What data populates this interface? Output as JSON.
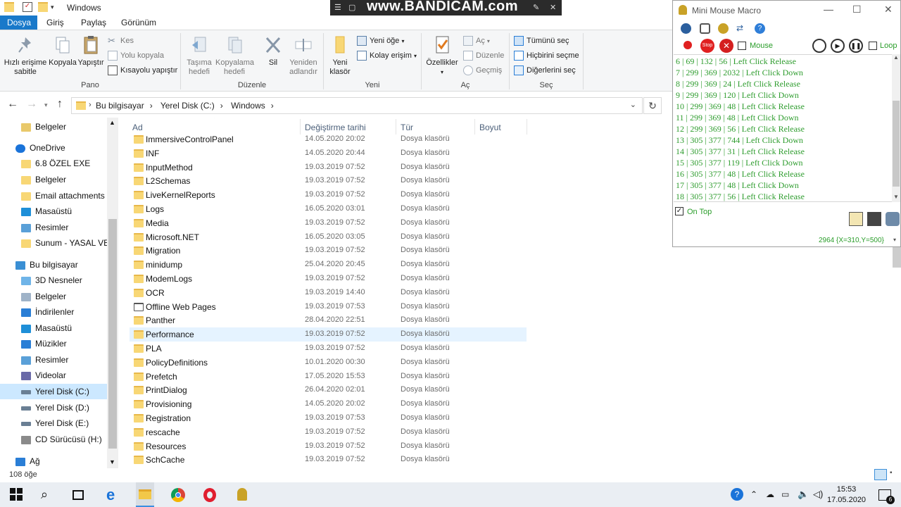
{
  "window": {
    "title": "Windows"
  },
  "tabs": {
    "file": "Dosya",
    "home": "Giriş",
    "share": "Paylaş",
    "view": "Görünüm"
  },
  "ribbon": {
    "pin": "Hızlı erişime sabitle",
    "copy": "Kopyala",
    "paste": "Yapıştır",
    "cut": "Kes",
    "copy_path": "Yolu kopyala",
    "paste_shortcut": "Kısayolu yapıştır",
    "group_clipboard": "Pano",
    "move_to": "Taşıma hedefi",
    "copy_to": "Kopyalama hedefi",
    "delete": "Sil",
    "rename": "Yeniden adlandır",
    "group_organize": "Düzenle",
    "new_folder": "Yeni klasör",
    "new_item": "Yeni öğe",
    "easy_access": "Kolay erişim",
    "group_new": "Yeni",
    "properties": "Özellikler",
    "open": "Aç",
    "edit": "Düzenle",
    "history": "Geçmiş",
    "group_open": "Aç",
    "select_all": "Tümünü seç",
    "select_none": "Hiçbirini seçme",
    "invert_selection": "Diğerlerini seç",
    "group_select": "Seç"
  },
  "address": {
    "crumbs": [
      "Bu bilgisayar",
      "Yerel Disk (C:)",
      "Windows"
    ]
  },
  "nav": {
    "items": [
      {
        "label": "Belgeler",
        "color": "#e9c96b"
      },
      {
        "label": "OneDrive",
        "color": "#1a73d9"
      },
      {
        "label": "6.8 ÖZEL EXE",
        "color": "#f8d775"
      },
      {
        "label": "Belgeler",
        "color": "#f8d775"
      },
      {
        "label": "Email attachments",
        "color": "#f8d775"
      },
      {
        "label": "Masaüstü",
        "color": "#1e8fd8"
      },
      {
        "label": "Resimler",
        "color": "#5aa0d8"
      },
      {
        "label": "Sunum - YASAL VE Y",
        "color": "#f8d775"
      },
      {
        "label": "Bu bilgisayar",
        "color": "#3a8fd4"
      },
      {
        "label": "3D Nesneler",
        "color": "#6fb4e8"
      },
      {
        "label": "Belgeler",
        "color": "#9fb3c8"
      },
      {
        "label": "İndirilenler",
        "color": "#2a7ed6"
      },
      {
        "label": "Masaüstü",
        "color": "#1e8fd8"
      },
      {
        "label": "Müzikler",
        "color": "#2a7ed6"
      },
      {
        "label": "Resimler",
        "color": "#5aa0d8"
      },
      {
        "label": "Videolar",
        "color": "#6a6aa8"
      },
      {
        "label": "Yerel Disk (C:)",
        "color": "#6a7f94"
      },
      {
        "label": "Yerel Disk (D:)",
        "color": "#6a7f94"
      },
      {
        "label": "Yerel Disk (E:)",
        "color": "#6a7f94"
      },
      {
        "label": "CD Sürücüsü (H:)",
        "color": "#8a8a8a"
      },
      {
        "label": "Ağ",
        "color": "#2a7ed6"
      }
    ]
  },
  "columns": {
    "name": "Ad",
    "date": "Değiştirme tarihi",
    "type": "Tür",
    "size": "Boyut"
  },
  "files": [
    {
      "name": "ImmersiveControlPanel",
      "date": "14.05.2020 20:02",
      "type": "Dosya klasörü"
    },
    {
      "name": "INF",
      "date": "14.05.2020 20:44",
      "type": "Dosya klasörü"
    },
    {
      "name": "InputMethod",
      "date": "19.03.2019 07:52",
      "type": "Dosya klasörü"
    },
    {
      "name": "L2Schemas",
      "date": "19.03.2019 07:52",
      "type": "Dosya klasörü"
    },
    {
      "name": "LiveKernelReports",
      "date": "19.03.2019 07:52",
      "type": "Dosya klasörü"
    },
    {
      "name": "Logs",
      "date": "16.05.2020 03:01",
      "type": "Dosya klasörü"
    },
    {
      "name": "Media",
      "date": "19.03.2019 07:52",
      "type": "Dosya klasörü"
    },
    {
      "name": "Microsoft.NET",
      "date": "16.05.2020 03:05",
      "type": "Dosya klasörü"
    },
    {
      "name": "Migration",
      "date": "19.03.2019 07:52",
      "type": "Dosya klasörü"
    },
    {
      "name": "minidump",
      "date": "25.04.2020 20:45",
      "type": "Dosya klasörü"
    },
    {
      "name": "ModemLogs",
      "date": "19.03.2019 07:52",
      "type": "Dosya klasörü"
    },
    {
      "name": "OCR",
      "date": "19.03.2019 14:40",
      "type": "Dosya klasörü"
    },
    {
      "name": "Offline Web Pages",
      "date": "19.03.2019 07:53",
      "type": "Dosya klasörü"
    },
    {
      "name": "Panther",
      "date": "28.04.2020 22:51",
      "type": "Dosya klasörü"
    },
    {
      "name": "Performance",
      "date": "19.03.2019 07:52",
      "type": "Dosya klasörü"
    },
    {
      "name": "PLA",
      "date": "19.03.2019 07:52",
      "type": "Dosya klasörü"
    },
    {
      "name": "PolicyDefinitions",
      "date": "10.01.2020 00:30",
      "type": "Dosya klasörü"
    },
    {
      "name": "Prefetch",
      "date": "17.05.2020 15:53",
      "type": "Dosya klasörü"
    },
    {
      "name": "PrintDialog",
      "date": "26.04.2020 02:01",
      "type": "Dosya klasörü"
    },
    {
      "name": "Provisioning",
      "date": "14.05.2020 20:02",
      "type": "Dosya klasörü"
    },
    {
      "name": "Registration",
      "date": "19.03.2019 07:53",
      "type": "Dosya klasörü"
    },
    {
      "name": "rescache",
      "date": "19.03.2019 07:52",
      "type": "Dosya klasörü"
    },
    {
      "name": "Resources",
      "date": "19.03.2019 07:52",
      "type": "Dosya klasörü"
    },
    {
      "name": "SchCache",
      "date": "19.03.2019 07:52",
      "type": "Dosya klasörü"
    }
  ],
  "status": {
    "count": "108 öğe"
  },
  "bandicam": {
    "text": "www.BANDICAM.com"
  },
  "macro": {
    "title": "Mini Mouse Macro",
    "mouse_label": "Mouse",
    "loop_label": "Loop",
    "log": [
      "6 | 69 | 132 | 56 | Left Click Release",
      "7 | 299 | 369 | 2032 | Left Click Down",
      "8 | 299 | 369 | 24 | Left Click Release",
      "9 | 299 | 369 | 120 | Left Click Down",
      "10 | 299 | 369 | 48 | Left Click Release",
      "11 | 299 | 369 | 48 | Left Click Down",
      "12 | 299 | 369 | 56 | Left Click Release",
      "13 | 305 | 377 | 744 | Left Click Down",
      "14 | 305 | 377 | 31 | Left Click Release",
      "15 | 305 | 377 | 119 | Left Click Down",
      "16 | 305 | 377 | 48 | Left Click Release",
      "17 | 305 | 377 | 48 | Left Click Down",
      "18 | 305 | 377 | 56 | Left Click Release"
    ],
    "on_top": "On Top",
    "coords": "2964  {X=310,Y=500}"
  },
  "taskbar": {
    "time": "15:53",
    "date": "17.05.2020",
    "notifications": "6"
  },
  "colors": {
    "accent": "#1979ca",
    "log_green": "#2f9d2f",
    "folder": "#f8d775",
    "selected": "#cce8ff"
  }
}
